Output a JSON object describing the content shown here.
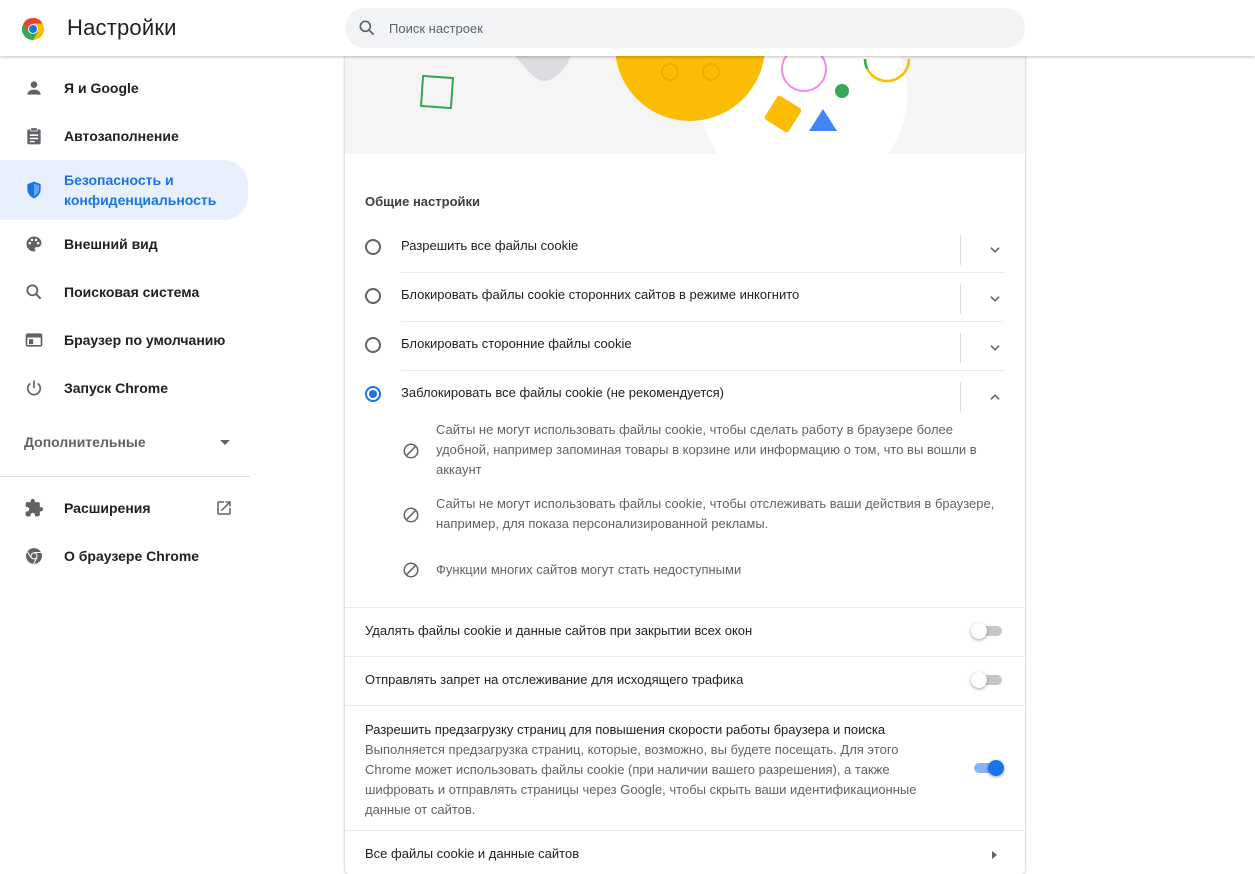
{
  "header": {
    "title": "Настройки",
    "search_placeholder": "Поиск настроек"
  },
  "sidebar": {
    "items": [
      {
        "label": "Я и Google",
        "icon": "person-icon"
      },
      {
        "label": "Автозаполнение",
        "icon": "clipboard-icon"
      },
      {
        "label": "Безопасность и конфиденциальность",
        "icon": "shield-icon",
        "active": true
      },
      {
        "label": "Внешний вид",
        "icon": "palette-icon"
      },
      {
        "label": "Поисковая система",
        "icon": "search-icon"
      },
      {
        "label": "Браузер по умолчанию",
        "icon": "browser-window-icon"
      },
      {
        "label": "Запуск Chrome",
        "icon": "power-icon"
      }
    ],
    "advanced_label": "Дополнительные",
    "extensions_label": "Расширения",
    "about_label": "О браузере Chrome"
  },
  "cookies": {
    "section_title": "Общие настройки",
    "options": [
      {
        "label": "Разрешить все файлы cookie",
        "checked": false,
        "expanded": false
      },
      {
        "label": "Блокировать файлы cookie сторонних сайтов в режиме инкогнито",
        "checked": false,
        "expanded": false
      },
      {
        "label": "Блокировать сторонние файлы cookie",
        "checked": false,
        "expanded": false
      },
      {
        "label": "Заблокировать все файлы cookie (не рекомендуется)",
        "checked": true,
        "expanded": true
      }
    ],
    "block_details": [
      "Сайты не могут использовать файлы cookie, чтобы сделать работу в браузере более удобной, например запоминая товары в корзине или информацию о том, что вы вошли в аккаунт",
      "Сайты не могут использовать файлы cookie, чтобы отслеживать ваши действия в браузере, например, для показа персонализированной рекламы.",
      "Функции многих сайтов могут стать недоступными"
    ],
    "toggles": [
      {
        "label": "Удалять файлы cookie и данные сайтов при закрытии всех окон",
        "on": false
      },
      {
        "label": "Отправлять запрет на отслеживание для исходящего трафика",
        "on": false
      }
    ],
    "preload": {
      "title": "Разрешить предзагрузку страниц для повышения скорости работы браузера и поиска",
      "description": "Выполняется предзагрузка страниц, которые, возможно, вы будете посещать. Для этого Chrome может использовать файлы cookie (при наличии вашего разрешения), а также шифровать и отправлять страницы через Google, чтобы скрыть ваши идентификационные данные от сайтов.",
      "on": true
    },
    "all_cookies_label": "Все файлы cookie и данные сайтов"
  },
  "colors": {
    "accent": "#1a73e8",
    "active_nav_bg": "#e8f0fe",
    "chrome_red": "#ea4335",
    "chrome_yellow": "#fbbc04",
    "chrome_green": "#34a853"
  }
}
